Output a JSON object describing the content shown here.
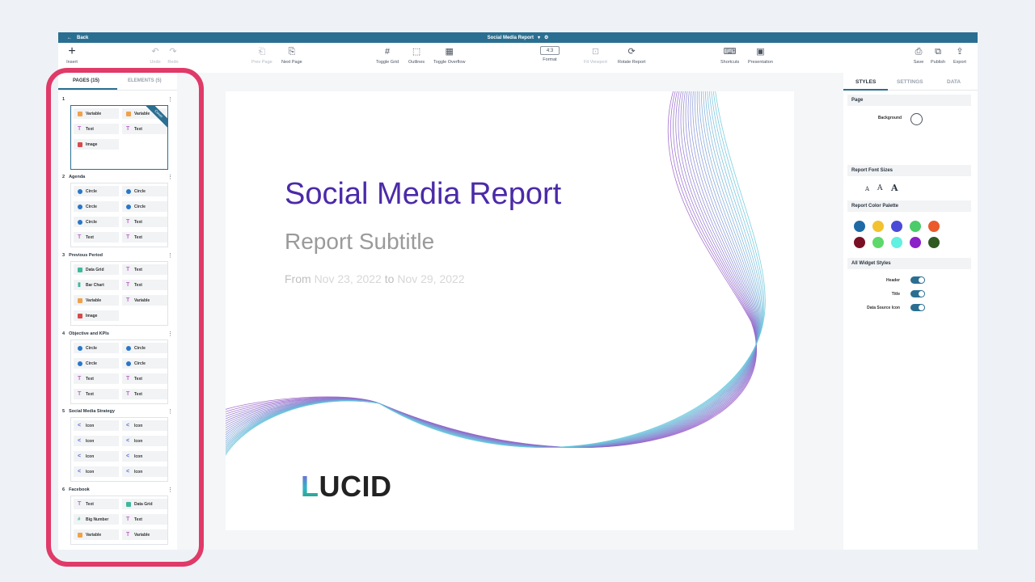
{
  "topbar": {
    "back_label": "Back",
    "title": "Social Media Report",
    "arrow_glyph": "←",
    "caret_glyph": "▾",
    "gear_glyph": "⚙"
  },
  "toolbar": {
    "insert": "Insert",
    "undo": "Undo",
    "redo": "Redo",
    "prev_page": "Prev Page",
    "next_page": "Next Page",
    "toggle_grid": "Toggle Grid",
    "outlines": "Outlines",
    "toggle_overflow": "Toggle Overflow",
    "format_value": "4:3",
    "format": "Format",
    "fit_viewport": "Fit Viewport",
    "rotate_report": "Rotate Report",
    "shortcuts": "Shortcuts",
    "presentation": "Presentation",
    "save": "Save",
    "publish": "Publish",
    "export": "Export"
  },
  "left_panel": {
    "tabs": [
      "PAGES (15)",
      "ELEMENTS (5)"
    ],
    "cover_badge": "Cover",
    "pages": [
      {
        "num": "1",
        "title": "",
        "items": [
          {
            "icon": "variable",
            "label": "Variable"
          },
          {
            "icon": "variable",
            "label": "Variable"
          },
          {
            "icon": "text",
            "label": "Text"
          },
          {
            "icon": "text",
            "label": "Text"
          },
          {
            "icon": "image",
            "label": "Image"
          }
        ]
      },
      {
        "num": "2",
        "title": "Agenda",
        "items": [
          {
            "icon": "circle",
            "label": "Circle"
          },
          {
            "icon": "circle",
            "label": "Circle"
          },
          {
            "icon": "circle",
            "label": "Circle"
          },
          {
            "icon": "circle",
            "label": "Circle"
          },
          {
            "icon": "circle",
            "label": "Circle"
          },
          {
            "icon": "text",
            "label": "Text"
          },
          {
            "icon": "text",
            "label": "Text"
          },
          {
            "icon": "text",
            "label": "Text"
          }
        ]
      },
      {
        "num": "3",
        "title": "Previous Period",
        "items": [
          {
            "icon": "grid",
            "label": "Data Grid"
          },
          {
            "icon": "text",
            "label": "Text"
          },
          {
            "icon": "bar",
            "label": "Bar Chart"
          },
          {
            "icon": "text",
            "label": "Text"
          },
          {
            "icon": "variable",
            "label": "Variable"
          },
          {
            "icon": "text",
            "label": "Variable"
          },
          {
            "icon": "image",
            "label": "Image"
          }
        ]
      },
      {
        "num": "4",
        "title": "Objective and KPIs",
        "items": [
          {
            "icon": "circle",
            "label": "Circle"
          },
          {
            "icon": "circle",
            "label": "Circle"
          },
          {
            "icon": "circle",
            "label": "Circle"
          },
          {
            "icon": "circle",
            "label": "Circle"
          },
          {
            "icon": "text",
            "label": "Text"
          },
          {
            "icon": "text",
            "label": "Text"
          },
          {
            "icon": "text",
            "label": "Text"
          },
          {
            "icon": "text",
            "label": "Text"
          }
        ]
      },
      {
        "num": "5",
        "title": "Social Media Strategy",
        "items": [
          {
            "icon": "share",
            "label": "Icon"
          },
          {
            "icon": "share",
            "label": "Icon"
          },
          {
            "icon": "share",
            "label": "Icon"
          },
          {
            "icon": "share",
            "label": "Icon"
          },
          {
            "icon": "share",
            "label": "Icon"
          },
          {
            "icon": "share",
            "label": "Icon"
          },
          {
            "icon": "share",
            "label": "Icon"
          },
          {
            "icon": "share",
            "label": "Icon"
          }
        ]
      },
      {
        "num": "6",
        "title": "Facebook",
        "items": [
          {
            "icon": "text",
            "label": "Text"
          },
          {
            "icon": "grid",
            "label": "Data Grid"
          },
          {
            "icon": "big",
            "label": "Big Number"
          },
          {
            "icon": "text",
            "label": "Text"
          },
          {
            "icon": "variable",
            "label": "Variable"
          },
          {
            "icon": "text",
            "label": "Variable"
          }
        ]
      }
    ]
  },
  "slide": {
    "title": "Social Media Report",
    "subtitle": "Report Subtitle",
    "date_from": "From",
    "date_start": "Nov 23, 2022",
    "date_to": "to",
    "date_end": "Nov 29, 2022",
    "logo_first": "L",
    "logo_rest": "UCID"
  },
  "right_panel": {
    "tabs": [
      "STYLES",
      "SETTINGS",
      "DATA"
    ],
    "page_section": "Page",
    "background_label": "Background",
    "font_sizes_section": "Report Font Sizes",
    "font_glyph": "A",
    "palette_section": "Report Color Palette",
    "palette": [
      "#1f6aa5",
      "#f2c230",
      "#4b4bd8",
      "#4ccb6a",
      "#ea5a2a",
      "#7a1025",
      "#5ed86a",
      "#62f0e0",
      "#8a22c8",
      "#2f5a22"
    ],
    "widget_section": "All Widget Styles",
    "toggles": [
      {
        "label": "Header",
        "on": true
      },
      {
        "label": "Title",
        "on": true
      },
      {
        "label": "Data Source Icon",
        "on": true
      }
    ]
  },
  "colors": {
    "accent": "#2a6f91",
    "title_purple": "#4b2aa8",
    "highlight": "#e03a68"
  }
}
